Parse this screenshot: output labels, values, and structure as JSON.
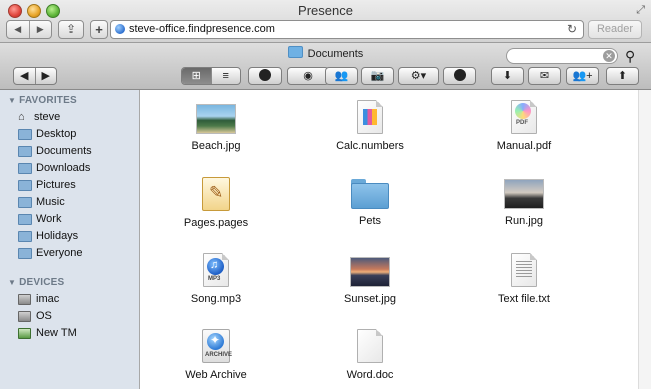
{
  "window": {
    "title": "Presence"
  },
  "browser": {
    "url": "steve-office.findpresence.com",
    "reader_label": "Reader",
    "nav_back_icon": "◀",
    "nav_forward_icon": "▶"
  },
  "toolbar": {
    "path_title": "Documents",
    "search_placeholder": "",
    "search_clear_icon": "✕",
    "buttons": {
      "back": "◀",
      "forward": "▶",
      "grid": "⊞",
      "list": "≡",
      "info": "i",
      "eye": "◉",
      "people": "👥",
      "camera": "📷",
      "gear": "⚙▾",
      "help": "?",
      "download": "⬇",
      "mail": "✉",
      "add_user": "👥+",
      "upload": "⬆"
    }
  },
  "sidebar": {
    "favorites_header": "FAVORITES",
    "favorites": [
      {
        "label": "steve",
        "icon": "home-icon"
      },
      {
        "label": "Desktop",
        "icon": "folder-icon"
      },
      {
        "label": "Documents",
        "icon": "folder-icon"
      },
      {
        "label": "Downloads",
        "icon": "folder-icon"
      },
      {
        "label": "Pictures",
        "icon": "folder-icon"
      },
      {
        "label": "Music",
        "icon": "folder-icon"
      },
      {
        "label": "Work",
        "icon": "folder-icon"
      },
      {
        "label": "Holidays",
        "icon": "folder-icon"
      },
      {
        "label": "Everyone",
        "icon": "folder-icon"
      }
    ],
    "devices_header": "DEVICES",
    "devices": [
      {
        "label": "imac",
        "icon": "disk-icon"
      },
      {
        "label": "OS",
        "icon": "disk-icon"
      },
      {
        "label": "New TM",
        "icon": "timemachine-disk-icon"
      }
    ]
  },
  "files": [
    {
      "name": "Beach.jpg",
      "kind": "photo"
    },
    {
      "name": "Calc.numbers",
      "kind": "numbers"
    },
    {
      "name": "Manual.pdf",
      "kind": "pdf"
    },
    {
      "name": "Pages.pages",
      "kind": "pages"
    },
    {
      "name": "Pets",
      "kind": "folder"
    },
    {
      "name": "Run.jpg",
      "kind": "photo"
    },
    {
      "name": "Song.mp3",
      "kind": "mp3"
    },
    {
      "name": "Sunset.jpg",
      "kind": "photo"
    },
    {
      "name": "Text file.txt",
      "kind": "text"
    },
    {
      "name": "Web Archive",
      "kind": "webarchive"
    },
    {
      "name": "Word.doc",
      "kind": "doc"
    }
  ],
  "badges": {
    "pdf": "PDF",
    "mp3": "MP3",
    "archive": "ARCHIVE"
  }
}
